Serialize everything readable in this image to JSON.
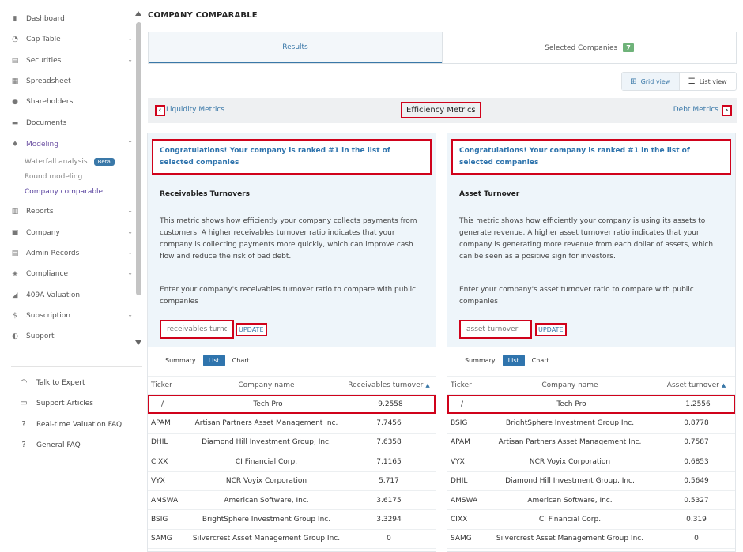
{
  "sidebar": {
    "items": [
      {
        "label": "Dashboard",
        "icon": "dashboard-icon",
        "glyph": "▮",
        "has_chevron": false
      },
      {
        "label": "Cap Table",
        "icon": "pie-chart-icon",
        "glyph": "◔",
        "has_chevron": true
      },
      {
        "label": "Securities",
        "icon": "clipboard-icon",
        "glyph": "▤",
        "has_chevron": true
      },
      {
        "label": "Spreadsheet",
        "icon": "spreadsheet-icon",
        "glyph": "▦",
        "has_chevron": false
      },
      {
        "label": "Shareholders",
        "icon": "person-icon",
        "glyph": "●",
        "has_chevron": false
      },
      {
        "label": "Documents",
        "icon": "folder-icon",
        "glyph": "▬",
        "has_chevron": false
      },
      {
        "label": "Modeling",
        "icon": "lightbulb-icon",
        "glyph": "♦",
        "has_chevron": true,
        "expanded": true
      },
      {
        "label": "Reports",
        "icon": "reports-icon",
        "glyph": "▥",
        "has_chevron": true
      },
      {
        "label": "Company",
        "icon": "building-icon",
        "glyph": "▣",
        "has_chevron": true
      },
      {
        "label": "Admin Records",
        "icon": "admin-records-icon",
        "glyph": "▤",
        "has_chevron": true
      },
      {
        "label": "Compliance",
        "icon": "shield-icon",
        "glyph": "◈",
        "has_chevron": true
      },
      {
        "label": "409A Valuation",
        "icon": "chart-icon",
        "glyph": "◢",
        "has_chevron": false
      },
      {
        "label": "Subscription",
        "icon": "dollar-icon",
        "glyph": "$",
        "has_chevron": true
      },
      {
        "label": "Support",
        "icon": "support-icon",
        "glyph": "◐",
        "has_chevron": false
      }
    ],
    "modeling_sub": [
      {
        "label": "Waterfall analysis",
        "badge": "Beta"
      },
      {
        "label": "Round modeling"
      },
      {
        "label": "Company comparable"
      }
    ],
    "help": [
      {
        "label": "Talk to Expert",
        "icon": "headset-icon",
        "glyph": "◠"
      },
      {
        "label": "Support Articles",
        "icon": "book-icon",
        "glyph": "▭"
      },
      {
        "label": "Real-time Valuation FAQ",
        "icon": "help-circle-icon",
        "glyph": "?"
      },
      {
        "label": "General FAQ",
        "icon": "help-circle-icon",
        "glyph": "?"
      }
    ]
  },
  "page": {
    "title": "COMPANY COMPARABLE",
    "tabs": [
      {
        "label": "Results"
      },
      {
        "label": "Selected Companies",
        "count": "7"
      }
    ],
    "views": {
      "grid": "Grid view",
      "list": "List view"
    },
    "metric_nav": {
      "prev": "Liquidity Metrics",
      "current": "Efficiency Metrics",
      "next": "Debt Metrics"
    }
  },
  "panels": {
    "left": {
      "congrats": "Congratulations! Your company is ranked #1 in the list of selected companies",
      "title": "Receivables Turnovers",
      "description": "This metric shows how efficiently your company collects payments from customers. A higher receivables turnover ratio indicates that your company is collecting payments more quickly, which can improve cash flow and reduce the risk of bad debt.",
      "prompt": "Enter your company's receivables turnover ratio to compare with public companies",
      "input_placeholder": "receivables turnover",
      "update_label": "UPDATE",
      "subtabs": [
        "Summary",
        "List",
        "Chart"
      ],
      "columns": {
        "ticker": "Ticker",
        "name": "Company name",
        "value": "Receivables turnover"
      },
      "rows": [
        {
          "ticker": "/",
          "name": "Tech Pro",
          "value": "9.2558"
        },
        {
          "ticker": "APAM",
          "name": "Artisan Partners Asset Management Inc.",
          "value": "7.7456"
        },
        {
          "ticker": "DHIL",
          "name": "Diamond Hill Investment Group, Inc.",
          "value": "7.6358"
        },
        {
          "ticker": "CIXX",
          "name": "CI Financial Corp.",
          "value": "7.1165"
        },
        {
          "ticker": "VYX",
          "name": "NCR Voyix Corporation",
          "value": "5.717"
        },
        {
          "ticker": "AMSWA",
          "name": "American Software, Inc.",
          "value": "3.6175"
        },
        {
          "ticker": "BSIG",
          "name": "BrightSphere Investment Group Inc.",
          "value": "3.3294"
        },
        {
          "ticker": "SAMG",
          "name": "Silvercrest Asset Management Group Inc.",
          "value": "0"
        }
      ]
    },
    "right": {
      "congrats": "Congratulations! Your company is ranked #1 in the list of selected companies",
      "title": "Asset Turnover",
      "description": "This metric shows how efficiently your company is using its assets to generate revenue. A higher asset turnover ratio indicates that your company is generating more revenue from each dollar of assets, which can be seen as a positive sign for investors.",
      "prompt": "Enter your company's asset turnover ratio to compare with public companies",
      "input_placeholder": "asset turnover",
      "update_label": "UPDATE",
      "subtabs": [
        "Summary",
        "List",
        "Chart"
      ],
      "columns": {
        "ticker": "Ticker",
        "name": "Company name",
        "value": "Asset turnover"
      },
      "rows": [
        {
          "ticker": "/",
          "name": "Tech Pro",
          "value": "1.2556"
        },
        {
          "ticker": "BSIG",
          "name": "BrightSphere Investment Group Inc.",
          "value": "0.8778"
        },
        {
          "ticker": "APAM",
          "name": "Artisan Partners Asset Management Inc.",
          "value": "0.7587"
        },
        {
          "ticker": "VYX",
          "name": "NCR Voyix Corporation",
          "value": "0.6853"
        },
        {
          "ticker": "DHIL",
          "name": "Diamond Hill Investment Group, Inc.",
          "value": "0.5649"
        },
        {
          "ticker": "AMSWA",
          "name": "American Software, Inc.",
          "value": "0.5327"
        },
        {
          "ticker": "CIXX",
          "name": "CI Financial Corp.",
          "value": "0.319"
        },
        {
          "ticker": "SAMG",
          "name": "Silvercrest Asset Management Group Inc.",
          "value": "0"
        }
      ]
    }
  },
  "colors": {
    "accent": "#3a78a8",
    "highlight_border": "#d0021b",
    "active_nav": "#6b4fa2",
    "badge": "#6fb37a"
  }
}
